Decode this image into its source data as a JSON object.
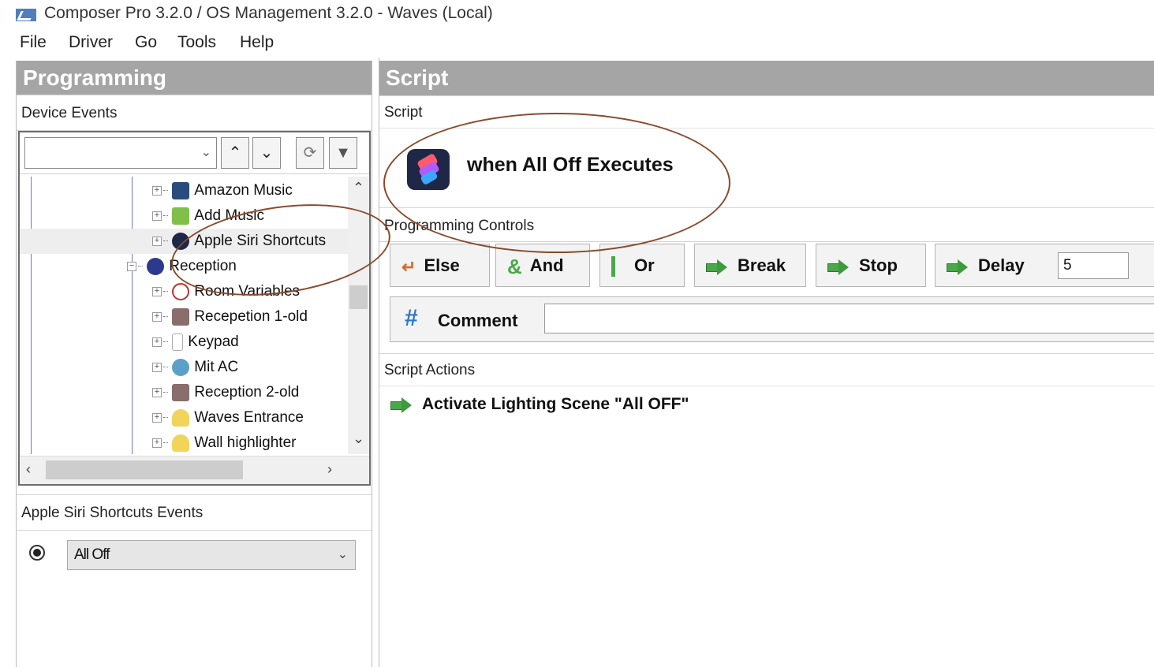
{
  "window": {
    "title": "Composer Pro 3.2.0 / OS Management 3.2.0 - Waves (Local)"
  },
  "menu": [
    "File",
    "Driver",
    "Go",
    "Tools",
    "Help"
  ],
  "left": {
    "header": "Programming",
    "device_events_label": "Device Events",
    "device_filter_value": "",
    "tree": [
      {
        "label": "Amazon Music",
        "icon": "amazon-music-icon",
        "level": 2
      },
      {
        "label": "Add Music",
        "icon": "music-icon",
        "level": 2
      },
      {
        "label": "Apple Siri Shortcuts",
        "icon": "siri-shortcuts-icon",
        "level": 2,
        "selected": true
      },
      {
        "label": "Reception",
        "icon": "room-icon",
        "level": 1,
        "expanded": true
      },
      {
        "label": "Room Variables",
        "icon": "variables-icon",
        "level": 2
      },
      {
        "label": "Recepetion 1-old",
        "icon": "device-icon",
        "level": 2
      },
      {
        "label": "Keypad",
        "icon": "keypad-icon",
        "level": 2
      },
      {
        "label": "Mit AC",
        "icon": "thermostat-icon",
        "level": 2
      },
      {
        "label": "Reception 2-old",
        "icon": "device-icon",
        "level": 2
      },
      {
        "label": "Waves Entrance",
        "icon": "light-icon",
        "level": 2
      },
      {
        "label": "Wall highlighter",
        "icon": "light-icon",
        "level": 2
      }
    ],
    "events_label": "Apple Siri Shortcuts Events",
    "event_selected": "All Off"
  },
  "right": {
    "header": "Script",
    "script_label": "Script",
    "script_title": "when All Off Executes",
    "controls_label": "Programming Controls",
    "controls": {
      "else": "Else",
      "and": "And",
      "or": "Or",
      "break": "Break",
      "stop": "Stop",
      "delay": "Delay"
    },
    "delay_value": "5",
    "comment_label": "Comment",
    "comment_value": "",
    "actions_label": "Script Actions",
    "actions": [
      "Activate Lighting Scene \"All OFF\""
    ]
  },
  "colors": {
    "header_bg": "#a5a5a5",
    "annotation": "#8a4a2a",
    "action_green": "#3d9b3d"
  }
}
